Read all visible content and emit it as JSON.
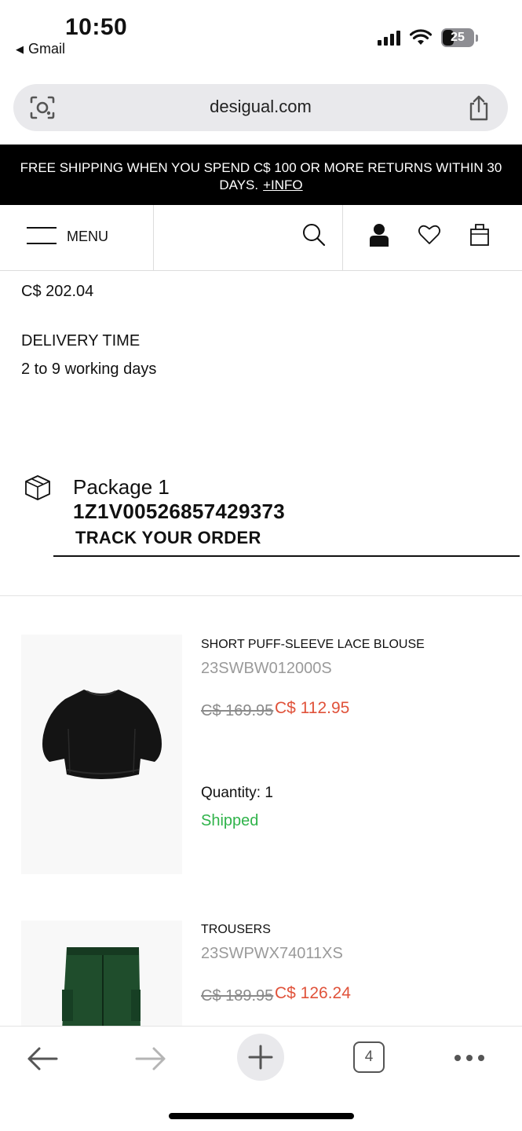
{
  "status_bar": {
    "time": "10:50",
    "back_app": "Gmail",
    "battery": "25"
  },
  "browser": {
    "url": "desigual.com",
    "tab_count": "4"
  },
  "banner": {
    "text": "FREE SHIPPING WHEN YOU SPEND C$ 100 OR MORE RETURNS WITHIN 30 DAYS.",
    "link": "+INFO"
  },
  "nav": {
    "menu_label": "MENU"
  },
  "order": {
    "total": "C$ 202.04",
    "delivery_title": "DELIVERY TIME",
    "delivery_value": "2 to 9 working days"
  },
  "package": {
    "label": "Package 1",
    "tracking_number": "1Z1V00526857429373",
    "track_link": "TRACK YOUR ORDER"
  },
  "products": [
    {
      "name": "SHORT PUFF-SLEEVE LACE BLOUSE",
      "ref": "23SWBW012000S",
      "old_price": "C$ 169.95",
      "new_price": "C$ 112.95",
      "quantity": "Quantity: 1",
      "status": "Shipped"
    },
    {
      "name": "TROUSERS",
      "ref": "23SWPWX74011XS",
      "old_price": "C$ 189.95",
      "new_price": "C$ 126.24"
    }
  ],
  "colors": {
    "sale": "#e0523a",
    "shipped": "#2fb34a",
    "banner_bg": "#000000"
  }
}
